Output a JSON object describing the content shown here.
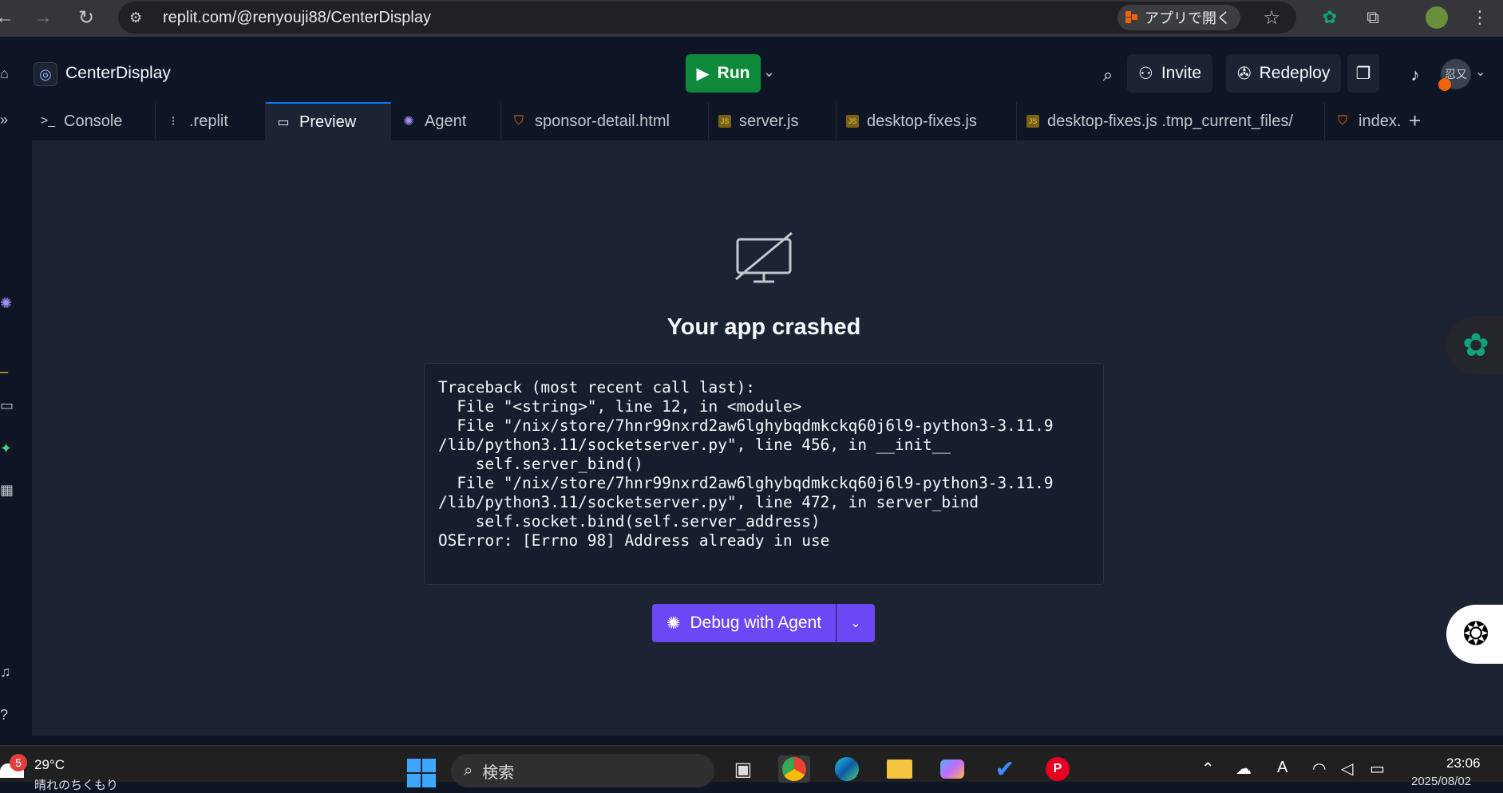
{
  "browser": {
    "url": "replit.com/@renyouji88/CenterDisplay",
    "open_app_label": "アプリで開く"
  },
  "header": {
    "repl_name": "CenterDisplay",
    "run_label": "Run",
    "invite_label": "Invite",
    "redeploy_label": "Redeploy",
    "user_initials": "忍又"
  },
  "tabs": [
    {
      "label": "Console",
      "icon": "console-icon"
    },
    {
      "label": ".replit",
      "icon": "config-icon"
    },
    {
      "label": "Preview",
      "icon": "monitor-icon",
      "active": true
    },
    {
      "label": "Agent",
      "icon": "agent-icon"
    },
    {
      "label": "sponsor-detail.html",
      "icon": "html-file-icon"
    },
    {
      "label": "server.js",
      "icon": "js-file-icon"
    },
    {
      "label": "desktop-fixes.js",
      "icon": "js-file-icon"
    },
    {
      "label": "desktop-fixes.js .tmp_current_files/",
      "icon": "js-file-icon"
    },
    {
      "label": "index.",
      "icon": "html-file-icon"
    }
  ],
  "preview": {
    "title": "Your app crashed",
    "traceback": "Traceback (most recent call last):\n  File \"<string>\", line 12, in <module>\n  File \"/nix/store/7hnr99nxrd2aw6lghybqdmkckq60j6l9-python3-3.11.9\n/lib/python3.11/socketserver.py\", line 456, in __init__\n    self.server_bind()\n  File \"/nix/store/7hnr99nxrd2aw6lghybqdmkckq60j6l9-python3-3.11.9\n/lib/python3.11/socketserver.py\", line 472, in server_bind\n    self.socket.bind(self.server_address)\nOSError: [Errno 98] Address already in use",
    "debug_label": "Debug with Agent"
  },
  "taskbar": {
    "weather_badge": "5",
    "temperature": "29°C",
    "weather_desc": "晴れのちくもり",
    "search_placeholder": "検索",
    "time": "23:06",
    "date": "2025/08/02"
  },
  "colors": {
    "run": "#0f8a3a",
    "debug": "#6b47f5",
    "active_tab_border": "#0079f2",
    "background": "#0e1525",
    "panel": "#1c2333"
  }
}
